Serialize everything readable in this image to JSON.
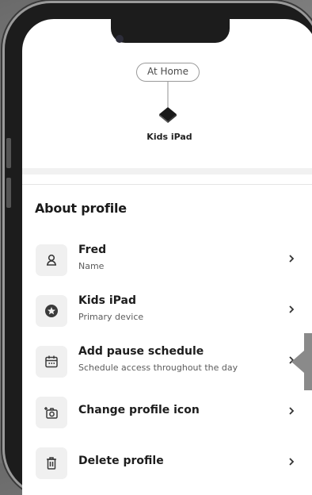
{
  "network": {
    "location_label": "At Home",
    "device_name": "Kids iPad"
  },
  "section": {
    "title": "About profile"
  },
  "rows": [
    {
      "title": "Fred",
      "subtitle": "Name",
      "icon": "person-icon"
    },
    {
      "title": "Kids iPad",
      "subtitle": "Primary device",
      "icon": "star-badge-icon"
    },
    {
      "title": "Add pause schedule",
      "subtitle": "Schedule access throughout the day",
      "icon": "calendar-icon"
    },
    {
      "title": "Change profile icon",
      "subtitle": "",
      "icon": "add-photo-icon"
    },
    {
      "title": "Delete profile",
      "subtitle": "",
      "icon": "trash-icon"
    }
  ],
  "colors": {
    "text_primary": "#1d1d1d",
    "text_secondary": "#5c5c5c",
    "icon_tile": "#f0f0f0",
    "background": "#ffffff"
  }
}
